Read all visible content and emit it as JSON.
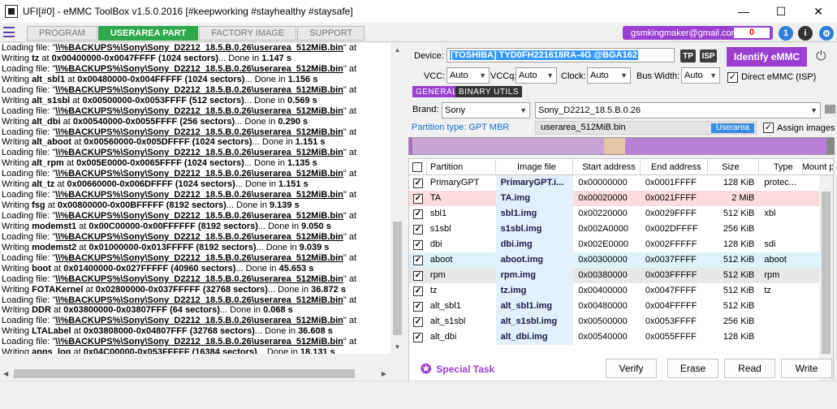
{
  "window": {
    "title": "UFI[#0] - eMMC ToolBox v1.5.0.2016 [#keepworking #stayhealthy #staysafe]",
    "min_glyph": "—",
    "max_glyph": "☐",
    "close_glyph": "✕"
  },
  "tabs": [
    {
      "label": "PROGRAM"
    },
    {
      "label": "USERAREA PART"
    },
    {
      "label": "FACTORY IMAGE"
    },
    {
      "label": "SUPPORT"
    }
  ],
  "user": {
    "email": "gsmkingmaker@gmail.com",
    "credits": "0"
  },
  "icons": {
    "update_badge": "1",
    "accent": "#9b3fd1",
    "tab_active_color": "#2ea84a"
  },
  "log": {
    "lines": [
      {
        "pre": "Loading file: \"",
        "file": "\\\\%BACKUPS%\\Sony\\Sony_D2212_18.5.B.0.26\\userarea_512MiB.bin",
        "post": "\" at"
      },
      {
        "pre": "Writing ",
        "name": "tz",
        "mid": " at ",
        "range": "0x00400000-0x0047FFFF (1024 sectors)",
        "done": "... Done in ",
        "time": "1.147 s"
      },
      {
        "pre": "Loading file: \"",
        "file": "\\\\%BACKUPS%\\Sony\\Sony_D2212_18.5.B.0.26\\userarea_512MiB.bin",
        "post": "\" at"
      },
      {
        "pre": "Writing ",
        "name": "alt_sbl1",
        "mid": " at ",
        "range": "0x00480000-0x004FFFFF (1024 sectors)",
        "done": "... Done in ",
        "time": "1.156 s"
      },
      {
        "pre": "Loading file: \"",
        "file": "\\\\%BACKUPS%\\Sony\\Sony_D2212_18.5.B.0.26\\userarea_512MiB.bin",
        "post": "\" at"
      },
      {
        "pre": "Writing ",
        "name": "alt_s1sbl",
        "mid": " at ",
        "range": "0x00500000-0x0053FFFF (512 sectors)",
        "done": "... Done in ",
        "time": "0.569 s"
      },
      {
        "pre": "Loading file: \"",
        "file": "\\\\%BACKUPS%\\Sony\\Sony_D2212_18.5.B.0.26\\userarea_512MiB.bin",
        "post": "\" at"
      },
      {
        "pre": "Writing ",
        "name": "alt_dbi",
        "mid": " at ",
        "range": "0x00540000-0x0055FFFF (256 sectors)",
        "done": "... Done in ",
        "time": "0.290 s"
      },
      {
        "pre": "Loading file: \"",
        "file": "\\\\%BACKUPS%\\Sony\\Sony_D2212_18.5.B.0.26\\userarea_512MiB.bin",
        "post": "\" at"
      },
      {
        "pre": "Writing ",
        "name": "alt_aboot",
        "mid": " at ",
        "range": "0x00560000-0x005DFFFF (1024 sectors)",
        "done": "... Done in ",
        "time": "1.151 s"
      },
      {
        "pre": "Loading file: \"",
        "file": "\\\\%BACKUPS%\\Sony\\Sony_D2212_18.5.B.0.26\\userarea_512MiB.bin",
        "post": "\" at"
      },
      {
        "pre": "Writing ",
        "name": "alt_rpm",
        "mid": " at ",
        "range": "0x005E0000-0x0065FFFF (1024 sectors)",
        "done": "... Done in ",
        "time": "1.135 s"
      },
      {
        "pre": "Loading file: \"",
        "file": "\\\\%BACKUPS%\\Sony\\Sony_D2212_18.5.B.0.26\\userarea_512MiB.bin",
        "post": "\" at"
      },
      {
        "pre": "Writing ",
        "name": "alt_tz",
        "mid": " at ",
        "range": "0x00660000-0x006DFFFF (1024 sectors)",
        "done": "... Done in ",
        "time": "1.151 s"
      },
      {
        "pre": "Loading file: \"",
        "file": "\\\\%BACKUPS%\\Sony\\Sony_D2212_18.5.B.0.26\\userarea_512MiB.bin",
        "post": "\" at"
      },
      {
        "pre": "Writing ",
        "name": "fsg",
        "mid": " at ",
        "range": "0x00800000-0x00BFFFFF (8192 sectors)",
        "done": "... Done in ",
        "time": "9.139 s"
      },
      {
        "pre": "Loading file: \"",
        "file": "\\\\%BACKUPS%\\Sony\\Sony_D2212_18.5.B.0.26\\userarea_512MiB.bin",
        "post": "\" at"
      },
      {
        "pre": "Writing ",
        "name": "modemst1",
        "mid": " at ",
        "range": "0x00C00000-0x00FFFFFF (8192 sectors)",
        "done": "... Done in ",
        "time": "9.050 s"
      },
      {
        "pre": "Loading file: \"",
        "file": "\\\\%BACKUPS%\\Sony\\Sony_D2212_18.5.B.0.26\\userarea_512MiB.bin",
        "post": "\" at"
      },
      {
        "pre": "Writing ",
        "name": "modemst2",
        "mid": " at ",
        "range": "0x01000000-0x013FFFFF (8192 sectors)",
        "done": "... Done in ",
        "time": "9.039 s"
      },
      {
        "pre": "Loading file: \"",
        "file": "\\\\%BACKUPS%\\Sony\\Sony_D2212_18.5.B.0.26\\userarea_512MiB.bin",
        "post": "\" at"
      },
      {
        "pre": "Writing ",
        "name": "boot",
        "mid": " at ",
        "range": "0x01400000-0x027FFFFF (40960 sectors)",
        "done": "... Done in ",
        "time": "45.653 s"
      },
      {
        "pre": "Loading file: \"",
        "file": "\\\\%BACKUPS%\\Sony\\Sony_D2212_18.5.B.0.26\\userarea_512MiB.bin",
        "post": "\" at"
      },
      {
        "pre": "Writing ",
        "name": "FOTAKernel",
        "mid": " at ",
        "range": "0x02800000-0x037FFFFF (32768 sectors)",
        "done": "... Done in ",
        "time": "36.872 s"
      },
      {
        "pre": "Loading file: \"",
        "file": "\\\\%BACKUPS%\\Sony\\Sony_D2212_18.5.B.0.26\\userarea_512MiB.bin",
        "post": "\" at"
      },
      {
        "pre": "Writing ",
        "name": "DDR",
        "mid": " at ",
        "range": "0x03800000-0x03807FFF (64 sectors)",
        "done": "... Done in ",
        "time": "0.068 s"
      },
      {
        "pre": "Loading file: \"",
        "file": "\\\\%BACKUPS%\\Sony\\Sony_D2212_18.5.B.0.26\\userarea_512MiB.bin",
        "post": "\" at"
      },
      {
        "pre": "Writing ",
        "name": "LTALabel",
        "mid": " at ",
        "range": "0x03808000-0x04807FFF (32768 sectors)",
        "done": "... Done in ",
        "time": "36.608 s"
      },
      {
        "pre": "Loading file: \"",
        "file": "\\\\%BACKUPS%\\Sony\\Sony_D2212_18.5.B.0.26\\userarea_512MiB.bin",
        "post": "\" at"
      },
      {
        "pre": "Writing ",
        "name": "apps_log",
        "mid": " at ",
        "range": "0x04C00000-0x053FFFFF (16384 sectors)",
        "done": "... Done in ",
        "time": "18.131 s"
      }
    ]
  },
  "device": {
    "label": "Device:",
    "value": "[TOSHIBA] TYD0FH221618RA-4G  @BGA162",
    "tp": "TP",
    "isp": "ISP",
    "identify": "Identify eMMC"
  },
  "settings": {
    "vcc_label": "VCC:",
    "vcc": "Auto",
    "vccq_label": "VCCq:",
    "vccq": "Auto",
    "clock_label": "Clock:",
    "clock": "Auto",
    "bus_label": "Bus Width:",
    "bus": "Auto",
    "direct_label": "Direct eMMC (ISP)"
  },
  "subtabs": {
    "general": "GENERAL",
    "binary": "BINARY UTILS"
  },
  "brand": {
    "label": "Brand:",
    "value": "Sony",
    "model": "Sony_D2212_18.5.B.0.26"
  },
  "partition_type": "Partition type: GPT MBR",
  "image_file": {
    "name": "userarea_512MiB.bin",
    "badge": "Userarea"
  },
  "assign_images": "Assign images",
  "table": {
    "headers": [
      "Partition",
      "Image file",
      "Start address",
      "End address",
      "Size",
      "Type",
      "Mount p"
    ],
    "rows": [
      {
        "name": "PrimaryGPT",
        "image": "PrimaryGPT.i...",
        "start": "0x00000000",
        "end": "0x0001FFFF",
        "size": "128 KiB",
        "type": "protec...",
        "hl": "none"
      },
      {
        "name": "TA",
        "image": "TA.img",
        "start": "0x00020000",
        "end": "0x0021FFFF",
        "size": "2 MiB",
        "type": "",
        "hl": "pink"
      },
      {
        "name": "sbl1",
        "image": "sbl1.img",
        "start": "0x00220000",
        "end": "0x0029FFFF",
        "size": "512 KiB",
        "type": "xbl",
        "hl": "none"
      },
      {
        "name": "s1sbl",
        "image": "s1sbl.img",
        "start": "0x002A0000",
        "end": "0x002DFFFF",
        "size": "256 KiB",
        "type": "",
        "hl": "none"
      },
      {
        "name": "dbi",
        "image": "dbi.img",
        "start": "0x002E0000",
        "end": "0x002FFFFF",
        "size": "128 KiB",
        "type": "sdi",
        "hl": "none"
      },
      {
        "name": "aboot",
        "image": "aboot.img",
        "start": "0x00300000",
        "end": "0x0037FFFF",
        "size": "512 KiB",
        "type": "aboot",
        "hl": "blue"
      },
      {
        "name": "rpm",
        "image": "rpm.img",
        "start": "0x00380000",
        "end": "0x003FFFFF",
        "size": "512 KiB",
        "type": "rpm",
        "hl": "grey"
      },
      {
        "name": "tz",
        "image": "tz.img",
        "start": "0x00400000",
        "end": "0x0047FFFF",
        "size": "512 KiB",
        "type": "tz",
        "hl": "none"
      },
      {
        "name": "alt_sbl1",
        "image": "alt_sbl1.img",
        "start": "0x00480000",
        "end": "0x004FFFFF",
        "size": "512 KiB",
        "type": "",
        "hl": "none"
      },
      {
        "name": "alt_s1sbl",
        "image": "alt_s1sbl.img",
        "start": "0x00500000",
        "end": "0x0053FFFF",
        "size": "256 KiB",
        "type": "",
        "hl": "none"
      },
      {
        "name": "alt_dbi",
        "image": "alt_dbi.img",
        "start": "0x00540000",
        "end": "0x0055FFFF",
        "size": "128 KiB",
        "type": "",
        "hl": "none"
      }
    ]
  },
  "actions": {
    "special": "Special Task",
    "verify": "Verify",
    "erase": "Erase",
    "read": "Read",
    "write": "Write"
  }
}
